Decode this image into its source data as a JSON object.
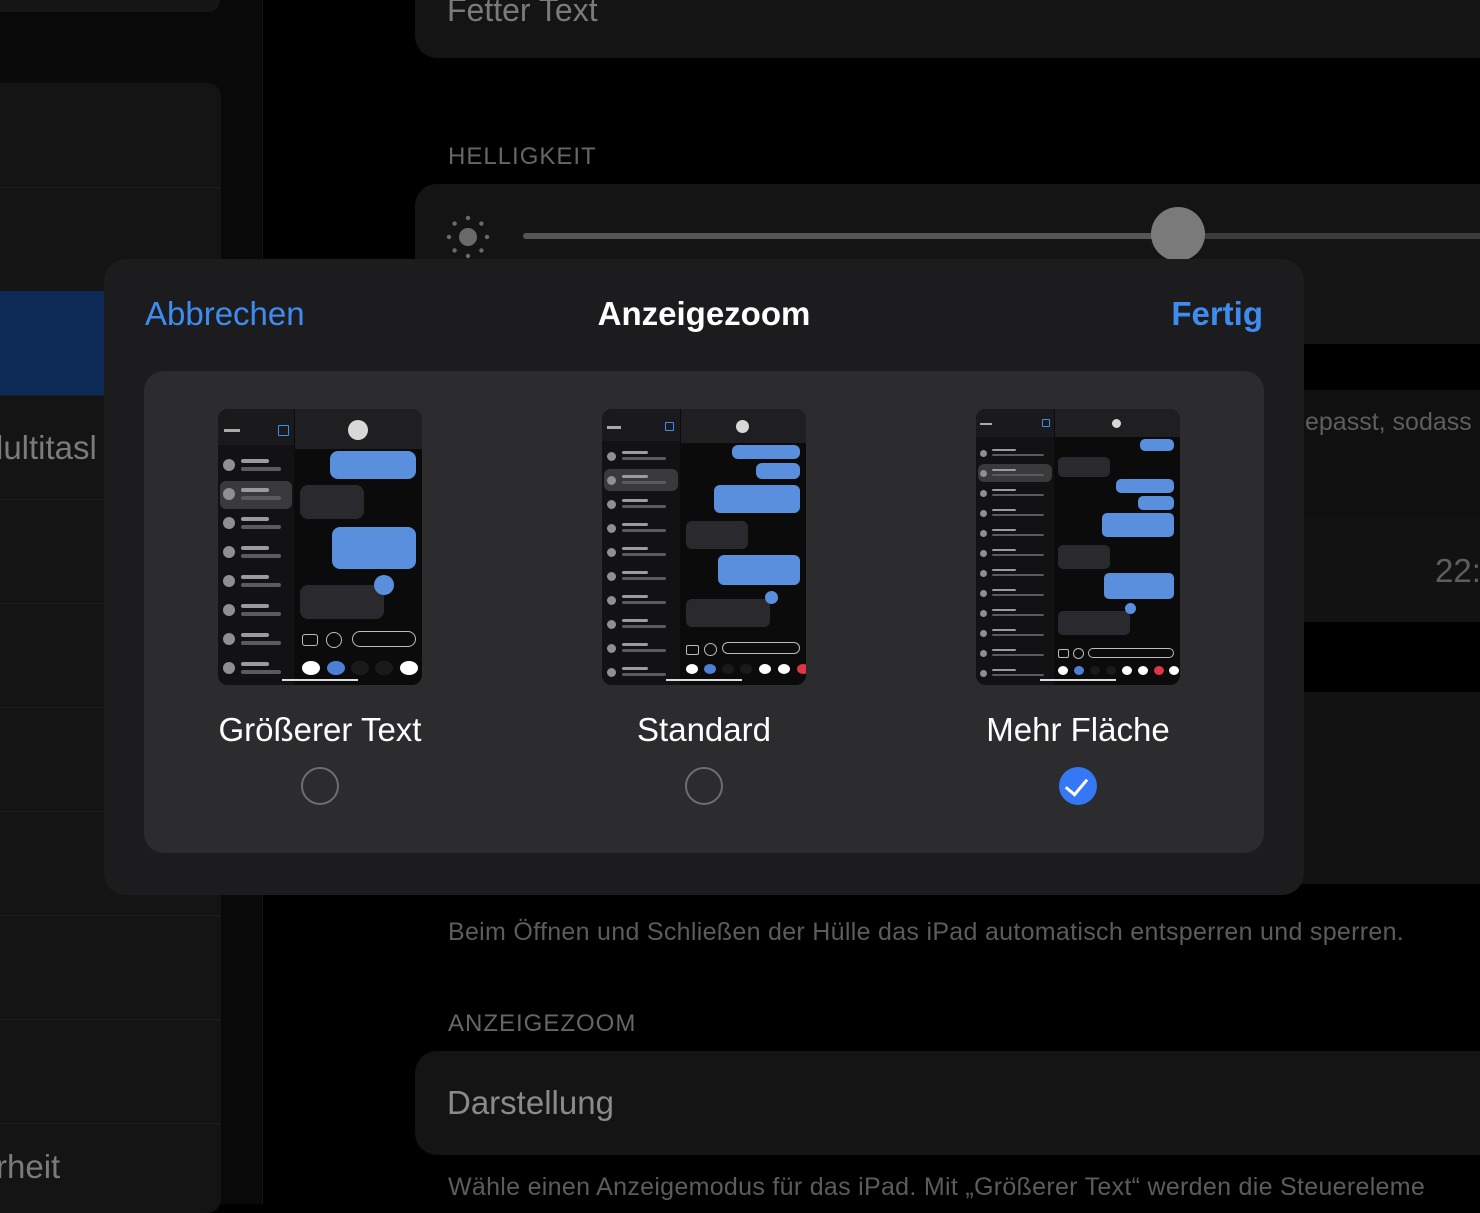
{
  "background": {
    "sidebar_partial_labels": [
      "lultitasl",
      "rheit"
    ],
    "top_card_text": "Fetter Text",
    "brightness_section": "HELLIGKEIT",
    "partial_text_right": "epasst, sodass",
    "partial_time": "22:",
    "cover_footnote": "Beim Öffnen und Schließen der Hülle das iPad automatisch entsperren und sperren.",
    "zoom_section": "ANZEIGEZOOM",
    "display_row": "Darstellung",
    "display_footnote": "Wähle einen Anzeigemodus für das iPad. Mit „Größerer Text“ werden die Steuereleme",
    "brightness_level": 0.66
  },
  "modal": {
    "cancel_label": "Abbrechen",
    "title": "Anzeigezoom",
    "done_label": "Fertig",
    "options": [
      {
        "label": "Größerer Text",
        "selected": false
      },
      {
        "label": "Standard",
        "selected": false
      },
      {
        "label": "Mehr Fläche",
        "selected": true
      }
    ]
  },
  "colors": {
    "accent": "#3f8cf0",
    "selected_radio": "#3478f6",
    "modal_bg": "#1c1c1e",
    "options_bg": "#2c2c2e"
  },
  "icons": [
    "sun-icon",
    "checkmark-icon",
    "camera-icon",
    "app-store-icon",
    "compose-icon",
    "avatar-icon"
  ]
}
